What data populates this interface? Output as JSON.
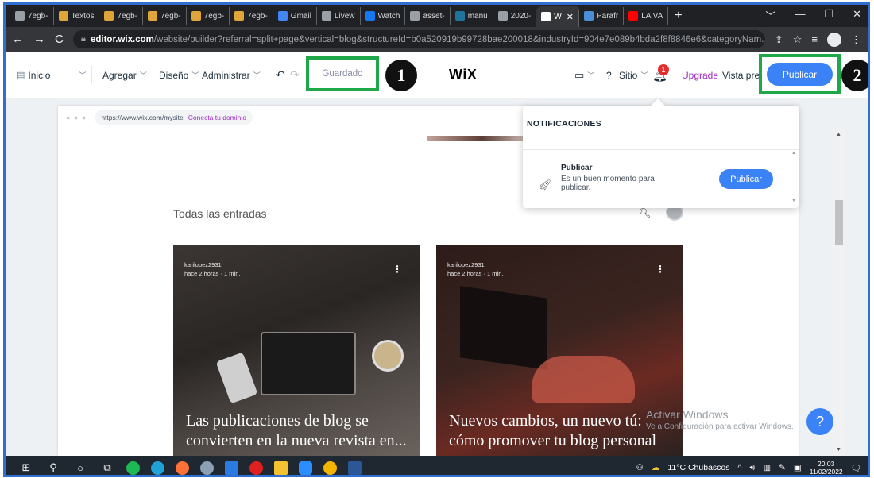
{
  "browser": {
    "tabs": [
      {
        "label": "7egb-",
        "icon": "globe-icon",
        "color": "#9aa0a6"
      },
      {
        "label": "Textos",
        "icon": "owl-icon",
        "color": "#e0a53a"
      },
      {
        "label": "7egb-",
        "icon": "owl-icon",
        "color": "#e0a53a"
      },
      {
        "label": "7egb-",
        "icon": "owl-icon",
        "color": "#e0a53a"
      },
      {
        "label": "7egb-",
        "icon": "owl-icon",
        "color": "#e0a53a"
      },
      {
        "label": "7egb-",
        "icon": "owl-icon",
        "color": "#e0a53a"
      },
      {
        "label": "Gmail",
        "icon": "google-icon",
        "color": "#4285f4"
      },
      {
        "label": "Livew",
        "icon": "globe-icon",
        "color": "#9aa0a6"
      },
      {
        "label": "Watch",
        "icon": "facebook-icon",
        "color": "#1877f2"
      },
      {
        "label": "asset-",
        "icon": "globe-icon",
        "color": "#9aa0a6"
      },
      {
        "label": "manu",
        "icon": "wordpress-icon",
        "color": "#21759b"
      },
      {
        "label": "2020-",
        "icon": "globe-icon",
        "color": "#9aa0a6"
      },
      {
        "label": "W",
        "icon": "wix-icon",
        "color": "#ffffff",
        "active": true
      },
      {
        "label": "Parafr",
        "icon": "owl-icon",
        "color": "#4a90d9"
      },
      {
        "label": "LA VA",
        "icon": "youtube-icon",
        "color": "#ff0000"
      }
    ],
    "new_tab": "+",
    "url_domain": "editor.wix.com",
    "url_rest": "/website/builder?referral=split+page&vertical=blog&structureId=b0a520919b99728bae200018&industryId=904e7e089b4bda2f8f8846e6&categoryNam..."
  },
  "wix_toolbar": {
    "page_label": "Inicio",
    "add_label": "Agregar",
    "design_label": "Diseño",
    "manage_label": "Administrar",
    "saved_label": "Guardado",
    "logo": "WiX",
    "help_label": "?",
    "site_label": "Sitio",
    "notification_count": "1",
    "upgrade_label": "Upgrade",
    "preview_label": "Vista previ",
    "publish_label": "Publicar",
    "upgrade_color": "#a12cc9"
  },
  "annotations": {
    "badge_1": "1",
    "badge_2": "2",
    "highlight_color": "#1ea84a"
  },
  "site": {
    "dots": "● ● ●",
    "url": "https://www.wix.com/mysite",
    "connect_domain": "Conecta tu dominio",
    "all_posts": "Todas las entradas",
    "posts": [
      {
        "author": "karilopez2931",
        "meta": "hace 2 horas · 1 min.",
        "title": "Las publicaciones de blog se convierten en la nueva revista en..."
      },
      {
        "author": "karilopez2931",
        "meta": "hace 2 horas · 1 min.",
        "title": "Nuevos cambios, un nuevo tú: cómo promover tu blog personal"
      }
    ]
  },
  "notifications": {
    "header": "NOTIFICACIONES",
    "item_title": "Publicar",
    "item_text": "Es un buen momento para publicar.",
    "item_button": "Publicar"
  },
  "windows_watermark": {
    "line1": "Activar Windows",
    "line2": "Ve a Configuración para activar Windows."
  },
  "help_button": "?",
  "taskbar": {
    "weather": "11°C Chubascos",
    "time": "20:03",
    "date": "11/02/2022"
  }
}
